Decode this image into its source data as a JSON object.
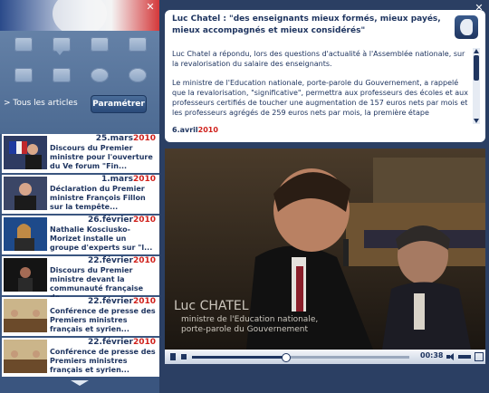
{
  "window": {
    "close_symbol": "✕"
  },
  "sidebar": {
    "tous_label": "> Tous les articles",
    "param_label": "Paramétrer",
    "icons": [
      "articles-icon",
      "comments-icon",
      "documents-icon",
      "folder-icon",
      "grid-icon",
      "video-icon",
      "camera-icon",
      "audio-icon"
    ],
    "items": [
      {
        "date": "25.mars",
        "year": "2010",
        "title": "Discours du Premier ministre pour l'ouverture du Ve forum \"Fin..."
      },
      {
        "date": "1.mars",
        "year": "2010",
        "title": "Déclaration du Premier ministre François Fillon sur la tempête..."
      },
      {
        "date": "26.février",
        "year": "2010",
        "title": "Nathalie Kosciusko-Morizet installe un groupe d'experts sur \"l..."
      },
      {
        "date": "22.février",
        "year": "2010",
        "title": "Discours du Premier ministre devant la communauté française de..."
      },
      {
        "date": "22.février",
        "year": "2010",
        "title": "Conférence de presse des Premiers ministres français et syrien..."
      },
      {
        "date": "22.février",
        "year": "2010",
        "title": "Conférence de presse des Premiers ministres français et syrien..."
      }
    ]
  },
  "article": {
    "title": "Luc Chatel : \"des enseignants mieux formés, mieux payés, mieux accompagnés et mieux considérés\"",
    "paragraph1": "Luc Chatel a répondu, lors des questions d'actualité à l'Assemblée nationale, sur la revalorisation du salaire des enseignants.",
    "paragraph2": "Le ministre de l'Education nationale, porte-parole du Gouvernement, a rappelé que la revalorisation, \"significative\", permettra aux professeurs des écoles et aux professeurs certifiés de toucher une augmentation de 157 euros nets par mois et les professeurs agrégés de 259 euros nets par mois, la première étape",
    "date": "6.avril",
    "year": "2010"
  },
  "video": {
    "caption_name": "Luc CHATEL",
    "caption_role1": "ministre de l'Education nationale,",
    "caption_role2": "porte-parole du Gouvernement",
    "time": "00:38",
    "progress": 0.43
  },
  "colors": {
    "panel": "#3a557f",
    "accent": "#1f3560",
    "year_red": "#d0211c",
    "bg": "#2b3f63"
  }
}
